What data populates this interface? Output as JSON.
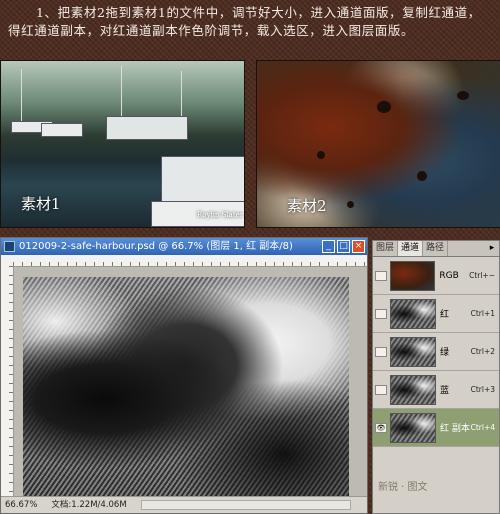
{
  "instruction": {
    "text": "1、把素材2拖到素材1的文件中，调节好大小，进入通道面版，复制红通道，得红通道副本，对红通道副本作色阶调节，载入选区，进入图层面版。"
  },
  "photos": {
    "left_label": "素材1",
    "left_credit": "Roylin Slater",
    "right_label": "素材2"
  },
  "document": {
    "title": "012009-2-safe-harbour.psd @ 66.7% (图层 1, 红 副本/8)",
    "status_zoom": "66.67%",
    "status_doc": "文档:1.22M/4.06M",
    "buttons": {
      "minimize": "_",
      "maximize": "□",
      "close": "×"
    }
  },
  "channels_panel": {
    "tabs": [
      "图层",
      "通道",
      "路径"
    ],
    "active_tab": "通道",
    "menu_glyph": "▸",
    "channels": [
      {
        "name": "RGB",
        "shortcut": "Ctrl+~",
        "visible": false,
        "selected": false,
        "thumb": "rgb"
      },
      {
        "name": "红",
        "shortcut": "Ctrl+1",
        "visible": false,
        "selected": false,
        "thumb": "gray"
      },
      {
        "name": "绿",
        "shortcut": "Ctrl+2",
        "visible": false,
        "selected": false,
        "thumb": "gray"
      },
      {
        "name": "蓝",
        "shortcut": "Ctrl+3",
        "visible": false,
        "selected": false,
        "thumb": "gray"
      },
      {
        "name": "红 副本",
        "shortcut": "Ctrl+4",
        "visible": true,
        "selected": true,
        "thumb": "gray"
      }
    ]
  },
  "watermark": "新锐 · 图文"
}
